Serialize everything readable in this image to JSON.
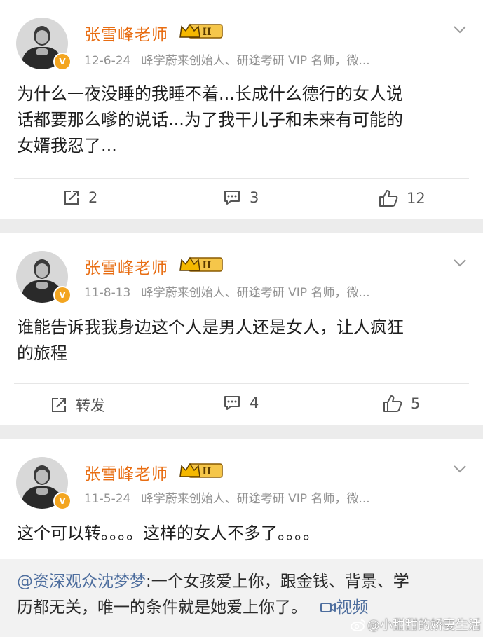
{
  "posts": [
    {
      "author": "张雪峰老师",
      "level_badge": "II",
      "verified_badge": "V",
      "date": "12-6-24",
      "bio": "峰学蔚来创始人、研途考研 VIP 名师，微...",
      "text_lines": [
        "为什么一夜没睡的我睡不着...长成什么德行的女人说",
        "话都要那么嗲的说话...为了我干儿子和未来有可能的",
        "女婿我忍了..."
      ],
      "repost_label": "2",
      "comment_count": "3",
      "like_count": "12"
    },
    {
      "author": "张雪峰老师",
      "level_badge": "II",
      "verified_badge": "V",
      "date": "11-8-13",
      "bio": "峰学蔚来创始人、研途考研 VIP 名师，微...",
      "text_lines": [
        "谁能告诉我我身边这个人是男人还是女人，让人疯狂",
        "的旅程"
      ],
      "repost_label": "转发",
      "comment_count": "4",
      "like_count": "5"
    },
    {
      "author": "张雪峰老师",
      "level_badge": "II",
      "verified_badge": "V",
      "date": "11-5-24",
      "bio": "峰学蔚来创始人、研途考研 VIP 名师，微...",
      "text_lines": [
        "这个可以转。。。。这样的女人不多了。。。。"
      ],
      "quoted": {
        "mention": "@资深观众沈梦梦",
        "line1_rest": ":一个女孩爱上你，跟金钱、背景、学",
        "line2": "历都无关，唯一的条件就是她爱上你了。",
        "video_label": "视频"
      }
    }
  ],
  "watermark": "@小甜甜的娇妻生活",
  "colors": {
    "name": "#e86d12",
    "meta": "#939393",
    "link": "#4e6e9e",
    "badge": "#f3a520"
  },
  "icons": [
    "repost-icon",
    "comment-icon",
    "like-icon",
    "chevron-down-icon",
    "crown-badge-icon",
    "video-icon",
    "weibo-logo-icon"
  ]
}
